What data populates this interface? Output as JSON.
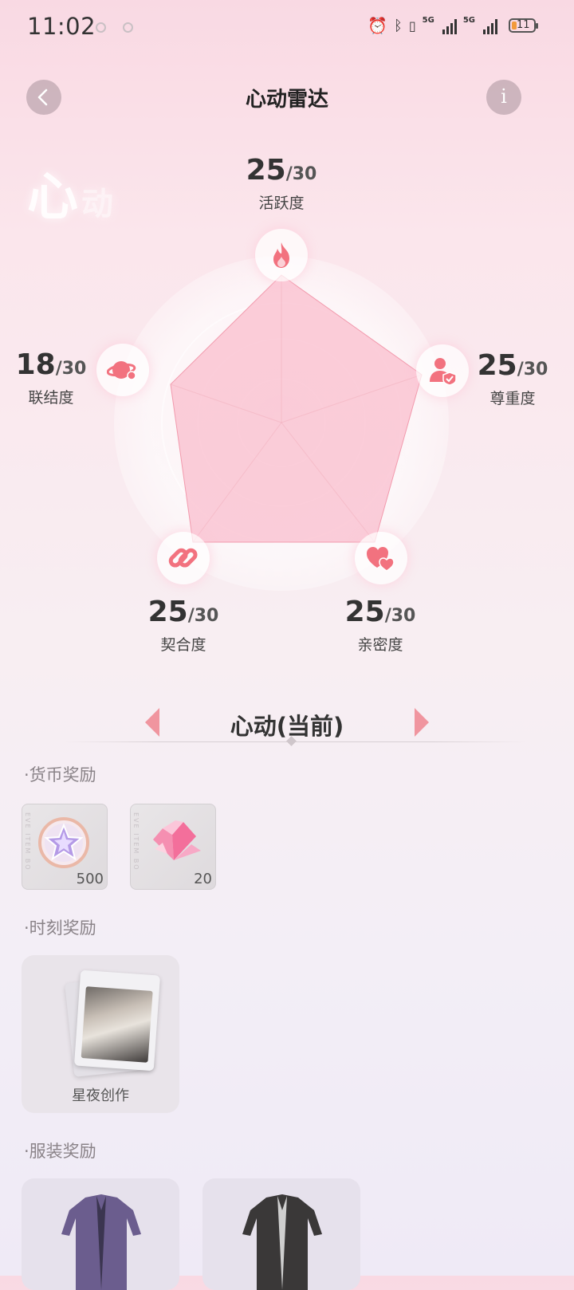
{
  "status_bar": {
    "time": "11:02",
    "network_1": "5G",
    "network_2": "5G",
    "battery": "11",
    "icons": [
      "alarm-icon",
      "bluetooth-icon",
      "vibrate-icon",
      "signal-icon",
      "signal-icon",
      "battery-icon"
    ]
  },
  "header": {
    "title": "心动雷达",
    "back_icon": "chevron-left-icon",
    "info_label": "i"
  },
  "watermark": {
    "big": "心",
    "small": "动"
  },
  "radar": {
    "max": "/30",
    "stats": [
      {
        "key": "activity",
        "score": "25",
        "max": "/30",
        "label": "活跃度",
        "icon": "fire-icon"
      },
      {
        "key": "respect",
        "score": "25",
        "max": "/30",
        "label": "尊重度",
        "icon": "user-shield-icon"
      },
      {
        "key": "intimacy",
        "score": "25",
        "max": "/30",
        "label": "亲密度",
        "icon": "hearts-icon"
      },
      {
        "key": "fit",
        "score": "25",
        "max": "/30",
        "label": "契合度",
        "icon": "link-icon"
      },
      {
        "key": "connection",
        "score": "18",
        "max": "/30",
        "label": "联结度",
        "icon": "planet-icon"
      }
    ],
    "colors": {
      "fill": "#f9c4d0",
      "stroke": "#f29aad",
      "icon": "#f2727f"
    }
  },
  "level_tabs": {
    "current": "心动(当前)"
  },
  "rewards": {
    "currency_label": "·货币奖励",
    "currency_items": [
      {
        "name": "star-coin",
        "qty": "500",
        "side_text": "EVE ITEM BO"
      },
      {
        "name": "pink-crystal",
        "qty": "20",
        "side_text": "EVE ITEM BO"
      }
    ],
    "moment_label": "·时刻奖励",
    "moment_item": {
      "caption": "星夜创作"
    },
    "outfit_label": "·服装奖励"
  }
}
